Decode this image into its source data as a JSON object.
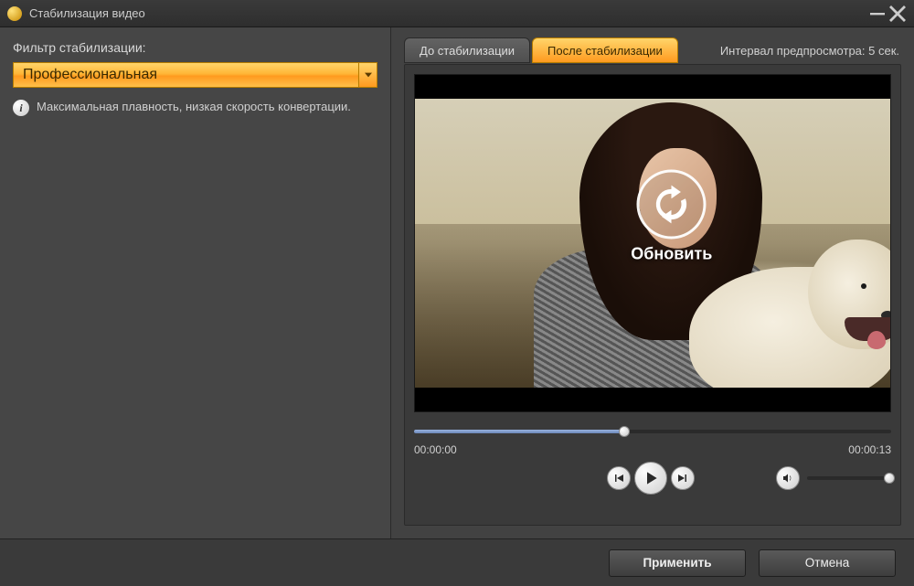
{
  "window": {
    "title": "Стабилизация видео"
  },
  "left": {
    "filter_label": "Фильтр стабилизации:",
    "dropdown_value": "Профессиональная",
    "info_text": "Максимальная плавность, низкая скорость конвертации."
  },
  "tabs": {
    "before": "До стабилизации",
    "after": "После стабилизации",
    "active": "after"
  },
  "preview": {
    "interval_label": "Интервал предпросмотра: 5 сек.",
    "refresh_label": "Обновить",
    "time_current": "00:00:00",
    "time_total": "00:00:13",
    "progress_fraction": 0.44
  },
  "footer": {
    "apply": "Применить",
    "cancel": "Отмена"
  },
  "colors": {
    "accent_gradient_top": "#ffd56a",
    "accent_gradient_bottom": "#ff9a1f",
    "panel_bg": "#424242"
  }
}
